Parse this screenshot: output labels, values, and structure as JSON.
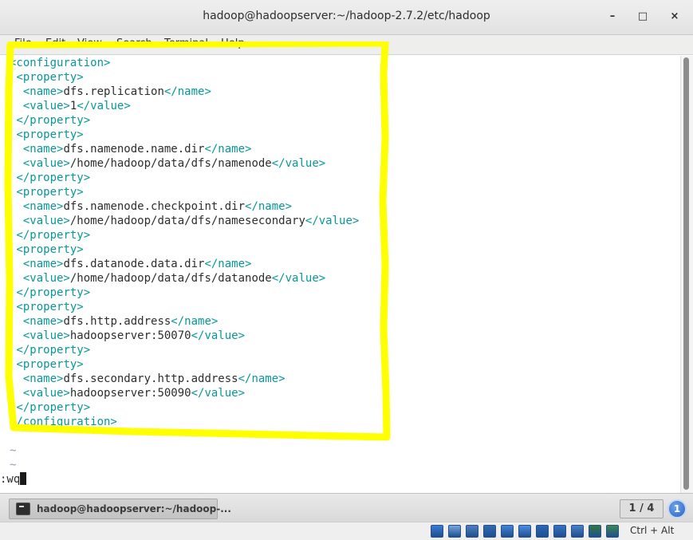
{
  "window": {
    "title": "hadoop@hadoopserver:~/hadoop-2.7.2/etc/hadoop",
    "minimize_glyph": "–",
    "maximize_glyph": "□",
    "close_glyph": "×"
  },
  "menu": [
    "File",
    "Edit",
    "View",
    "Search",
    "Terminal",
    "Help"
  ],
  "editor": {
    "lines": [
      {
        "indent": "",
        "open": "<configuration>"
      },
      {
        "indent": " ",
        "open": "<property>"
      },
      {
        "indent": "  ",
        "open": "<name>",
        "text": "dfs.replication",
        "close": "</name>"
      },
      {
        "indent": "  ",
        "open": "<value>",
        "text": "1",
        "close": "</value>"
      },
      {
        "indent": " ",
        "open": "</property>"
      },
      {
        "indent": " ",
        "open": "<property>"
      },
      {
        "indent": "  ",
        "open": "<name>",
        "text": "dfs.namenode.name.dir",
        "close": "</name>"
      },
      {
        "indent": "  ",
        "open": "<value>",
        "text": "/home/hadoop/data/dfs/namenode",
        "close": "</value>"
      },
      {
        "indent": " ",
        "open": "</property>"
      },
      {
        "indent": " ",
        "open": "<property>"
      },
      {
        "indent": "  ",
        "open": "<name>",
        "text": "dfs.namenode.checkpoint.dir",
        "close": "</name>"
      },
      {
        "indent": "  ",
        "open": "<value>",
        "text": "/home/hadoop/data/dfs/namesecondary",
        "close": "</value>"
      },
      {
        "indent": " ",
        "open": "</property>"
      },
      {
        "indent": " ",
        "open": "<property>"
      },
      {
        "indent": "  ",
        "open": "<name>",
        "text": "dfs.datanode.data.dir",
        "close": "</name>"
      },
      {
        "indent": "  ",
        "open": "<value>",
        "text": "/home/hadoop/data/dfs/datanode",
        "close": "</value>"
      },
      {
        "indent": " ",
        "open": "</property>"
      },
      {
        "indent": " ",
        "open": "<property>"
      },
      {
        "indent": "  ",
        "open": "<name>",
        "text": "dfs.http.address",
        "close": "</name>"
      },
      {
        "indent": "  ",
        "open": "<value>",
        "text": "hadoopserver:50070",
        "close": "</value>"
      },
      {
        "indent": " ",
        "open": "</property>"
      },
      {
        "indent": " ",
        "open": "<property>"
      },
      {
        "indent": "  ",
        "open": "<name>",
        "text": "dfs.secondary.http.address",
        "close": "</name>"
      },
      {
        "indent": "  ",
        "open": "<value>",
        "text": "hadoopserver:50090",
        "close": "</value>"
      },
      {
        "indent": " ",
        "open": "</property>"
      },
      {
        "indent": "",
        "open": "</configuration>"
      }
    ],
    "tildes": [
      "~",
      "~"
    ],
    "command": ":wq"
  },
  "taskbar": {
    "task_label": "hadoop@hadoopserver:~/hadoop-...",
    "workspace": "1 / 4",
    "notification_count": "1"
  },
  "statusbar": {
    "icons": [
      {
        "name": "hard-disk-icon",
        "color": "#3a7bd5"
      },
      {
        "name": "optical-drive-icon",
        "color": "#7aa6e0"
      },
      {
        "name": "audio-icon",
        "color": "#4f7fbf"
      },
      {
        "name": "network-icon",
        "color": "#2f6db3"
      },
      {
        "name": "usb-icon",
        "color": "#3f86d6"
      },
      {
        "name": "shared-folders-icon",
        "color": "#4a90e2"
      },
      {
        "name": "display-icon",
        "color": "#2d67b7"
      },
      {
        "name": "video-capture-icon",
        "color": "#3573c4"
      },
      {
        "name": "cpu-icon",
        "color": "#4a7fc9"
      },
      {
        "name": "mouse-integration-icon",
        "color": "#2f7c3a"
      },
      {
        "name": "keyboard-capture-icon",
        "color": "#3b8a4a"
      }
    ],
    "host_key": "Ctrl + Alt"
  },
  "colors": {
    "tag": "#06989a",
    "highlight": "#ffff00"
  }
}
